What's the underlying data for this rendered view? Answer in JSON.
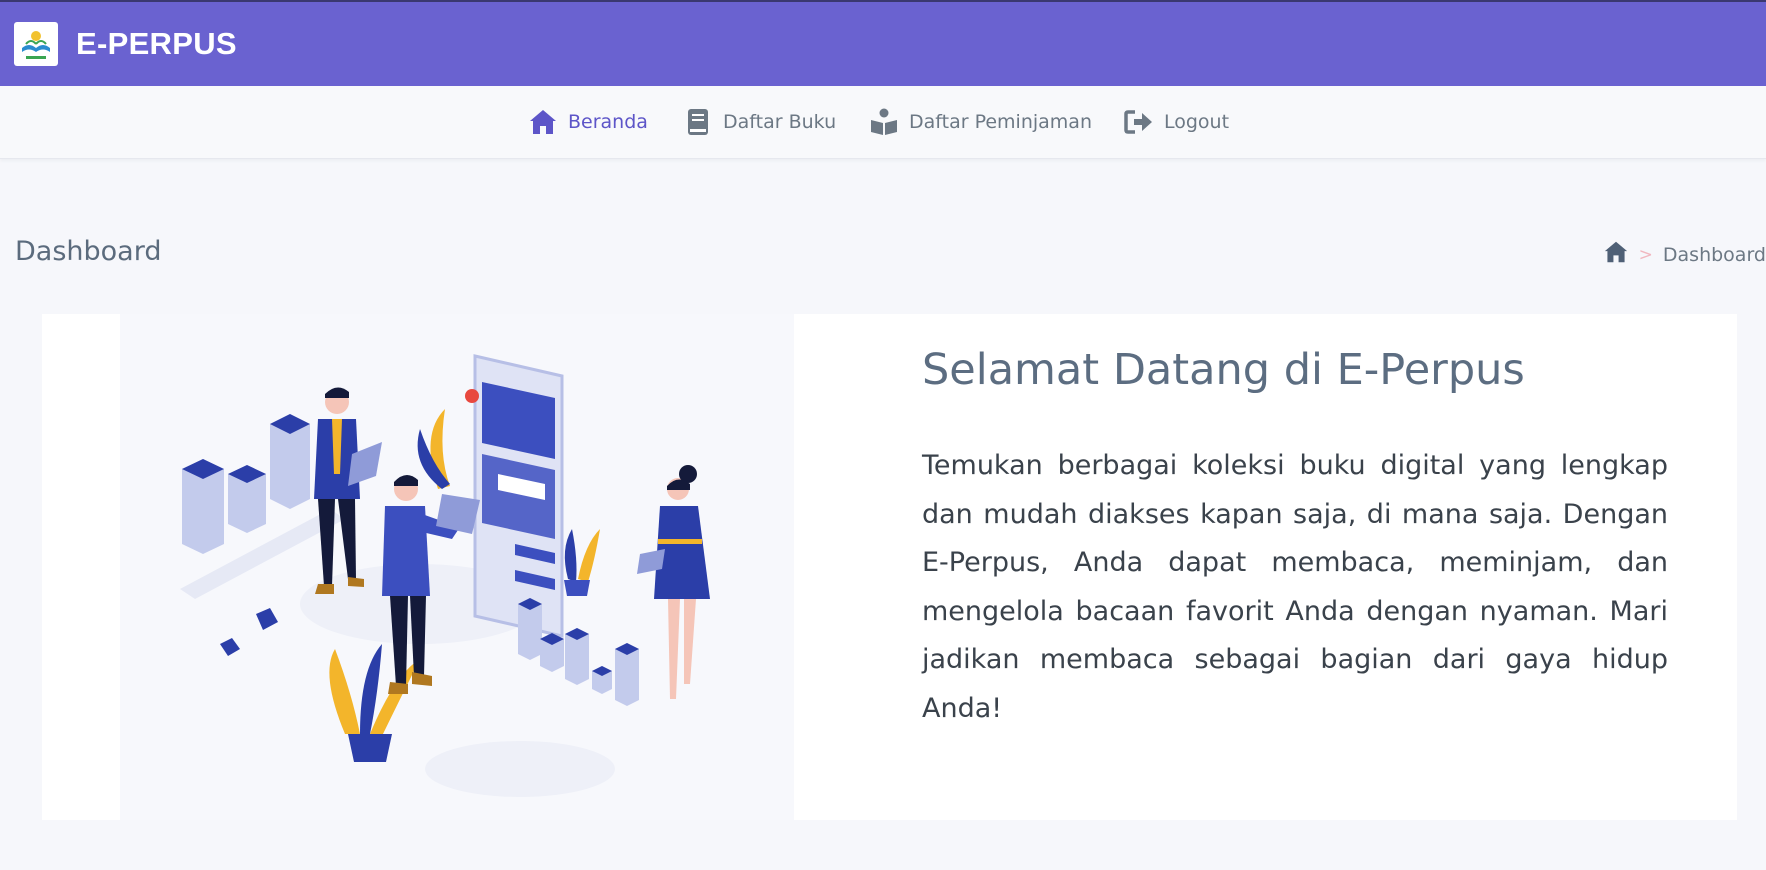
{
  "header": {
    "brand": "E-PERPUS",
    "logo_icon": "library-logo-icon"
  },
  "nav": {
    "items": [
      {
        "label": "Beranda",
        "icon": "home-icon",
        "active": true
      },
      {
        "label": "Daftar Buku",
        "icon": "book-icon",
        "active": false
      },
      {
        "label": "Daftar Peminjaman",
        "icon": "book-reader-icon",
        "active": false
      },
      {
        "label": "Logout",
        "icon": "logout-icon",
        "active": false
      }
    ]
  },
  "page": {
    "title": "Dashboard",
    "breadcrumb": {
      "home_icon": "home-icon",
      "separator": ">",
      "current": "Dashboard"
    }
  },
  "welcome": {
    "title": "Selamat Datang di E-Perpus",
    "text": "Temukan berbagai koleksi buku digital yang lengkap dan mudah diakses kapan saja, di mana saja. Dengan E-Perpus, Anda dapat membaca, meminjam, dan mengelola bacaan favorit Anda dengan nyaman. Mari jadikan membaca sebagai bagian dari gaya hidup Anda!"
  },
  "colors": {
    "header_bg": "#6a62d0",
    "accent": "#5d55c8",
    "illustration_blue": "#2b3ea8",
    "illustration_yellow": "#f3b52b"
  }
}
